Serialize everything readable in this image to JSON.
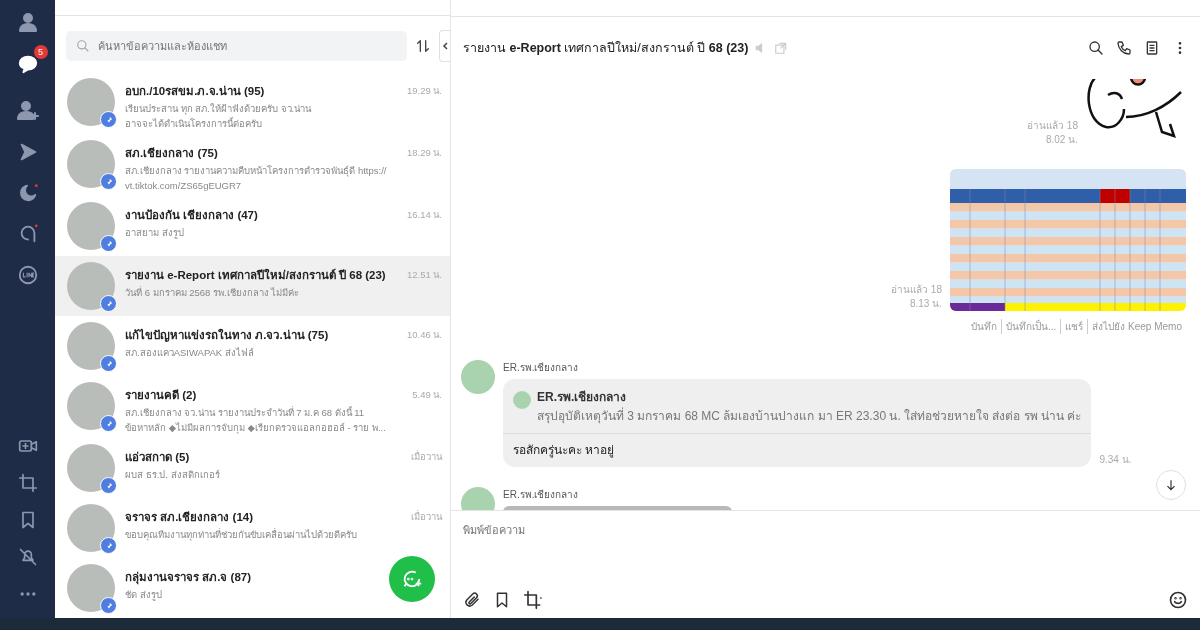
{
  "sidebar": {
    "chat_badge": "5"
  },
  "search": {
    "placeholder": "ค้นหาข้อความและห้องแชท"
  },
  "chats": [
    {
      "name": "อบก./10รสขม.ภ.จ.น่าน (95)",
      "preview": [
        "เรียนประสาน ทุก สภ.ให้ฝ้าฟังด้วยครับ  จว.น่าน",
        "อาจจะได้ดำเนินโครงการนี้ต่อครับ"
      ],
      "time": "19.29 น.",
      "pinned": true,
      "selected": false
    },
    {
      "name": "สภ.เชียงกลาง (75)",
      "preview": [
        "สภ.เชียงกลาง รายงานความคืบหน้าโครงการตำรวจพันธุ์ดี https://",
        "vt.tiktok.com/ZS65gEUGR7"
      ],
      "time": "18.29 น.",
      "pinned": true,
      "selected": false
    },
    {
      "name": "งานป้องกัน เชียงกลาง (47)",
      "preview": [
        "อาสยาม ส่งรูป"
      ],
      "time": "16.14 น.",
      "pinned": true,
      "selected": false
    },
    {
      "name": "รายงาน e-Report เทศกาลปีใหม่/สงกรานต์ ปี 68 (23)",
      "preview": [
        "วันที่ 6 มกราคม 2568 รพ.เชียงกลาง ไม่มีค่ะ"
      ],
      "time": "12.51 น.",
      "pinned": true,
      "selected": true
    },
    {
      "name": "แก้ไขปัญหาแข่งรถในทาง ภ.จว.น่าน (75)",
      "preview": [
        "สภ.สองแควASIWAPAK ส่งไฟล์"
      ],
      "time": "10.46 น.",
      "pinned": true,
      "selected": false
    },
    {
      "name": "รายงานคดี (2)",
      "preview": [
        "สภ.เชียงกลาง  จว.น่าน รายงานประจำวันที่ 7 ม.ค 68 ดังนี้ 11",
        "ข้อหาหลัก  ◆ไม่มีผลการจับกุม ◆เรียกตรวจแอลกอฮอล์ - ราย พ..."
      ],
      "time": "5.49 น.",
      "pinned": true,
      "selected": false
    },
    {
      "name": "แอ่วสกาด (5)",
      "preview": [
        "ผบส ธร.ป. ส่งสติกเกอร์"
      ],
      "time": "เมื่อวาน",
      "pinned": true,
      "selected": false
    },
    {
      "name": "จราจร สภ.เชียงกลาง (14)",
      "preview": [
        "ขอบคุณทีมงานทุกท่านที่ช่วยกันขับเคลื่อนผ่านไปด้วยดีครับ"
      ],
      "time": "เมื่อวาน",
      "pinned": true,
      "selected": false
    },
    {
      "name": "กลุ่มงานจราจร สภ.จ (87)",
      "preview": [
        "ชัด ส่งรูป"
      ],
      "pinned": true,
      "selected": false
    }
  ],
  "chat": {
    "title": "รายงาน **e-Report** เทศกาลปีใหม่/สงกรานต์ ปี **68 (23)**",
    "messages": [
      {
        "kind": "sticker",
        "read": "อ่านแล้ว 18",
        "time": "8.02 น."
      },
      {
        "kind": "image",
        "read": "อ่านแล้ว 18",
        "time": "8.13 น.",
        "actions": [
          "บันทึก",
          "บันทึกเป็น...",
          "แชร์",
          "ส่งไปยัง Keep Memo"
        ]
      },
      {
        "kind": "reply",
        "sender": "ER.รพ.เชียงกลาง",
        "quote_sender": "ER.รพ.เชียงกลาง",
        "quote": "สรุปอุบัติเหตุวันที่ 3 มกราคม 68 MC ล้มเองบ้านปางแก มา ER 23.30 น. ใส่ท่อช่วยหายใจ ส่งต่อ รพ น่าน ค่ะ",
        "text": "รอสักครู่นะคะ หาอยู่",
        "time": "9.34 น."
      },
      {
        "kind": "photo",
        "sender": "ER.รพ.เชียงกลาง"
      }
    ],
    "input": {
      "placeholder": "พิมพ์ข้อความ"
    }
  }
}
